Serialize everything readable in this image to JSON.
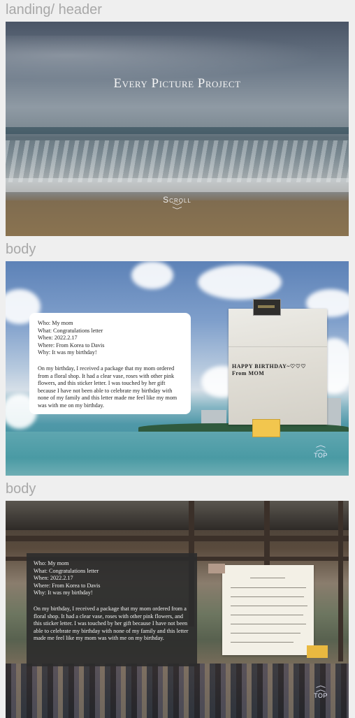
{
  "sections": {
    "landing_label": "landing/ header",
    "body1_label": "body",
    "body2_label": "body"
  },
  "landing": {
    "title": "Every Picture Project",
    "scroll_label": "Scroll",
    "scroll_icon": "double-chevron-down-icon"
  },
  "body1": {
    "card": {
      "who": "Who: My mom",
      "what": "What: Congratulations letter",
      "when": "When: 2022.2.17",
      "where": "Where: From Korea to Davis",
      "why": "Why: It was my birthday!",
      "story": "On my birthday, I received a package that my mom ordered from a floral shop. It had a clear vase, roses with other pink flowers, and this sticker letter. I was touched by her gift because I have not been able to celebrate my birthday with none of my family and this letter made me feel like my mom was with me on my birthday."
    },
    "photo_text_line1": "HAPPY BIRTHDAY~♡♡♡",
    "photo_text_line2": "From MOM",
    "top_label": "TOP"
  },
  "body2": {
    "card": {
      "who": "Who: My mom",
      "what": "What: Congratulations letter",
      "when": "When: 2022.2.17",
      "where": "Where: From Korea to Davis",
      "why": "Why: It was my birthday!",
      "story": "On my birthday, I received a package that my mom ordered from a floral shop. It had a clear vase, roses with other pink flowers, and this sticker letter. I was touched by her gift because I have not been able to celebrate my birthday with none of my family and this letter made me feel like my mom was with me on my birthday."
    },
    "top_label": "TOP"
  }
}
